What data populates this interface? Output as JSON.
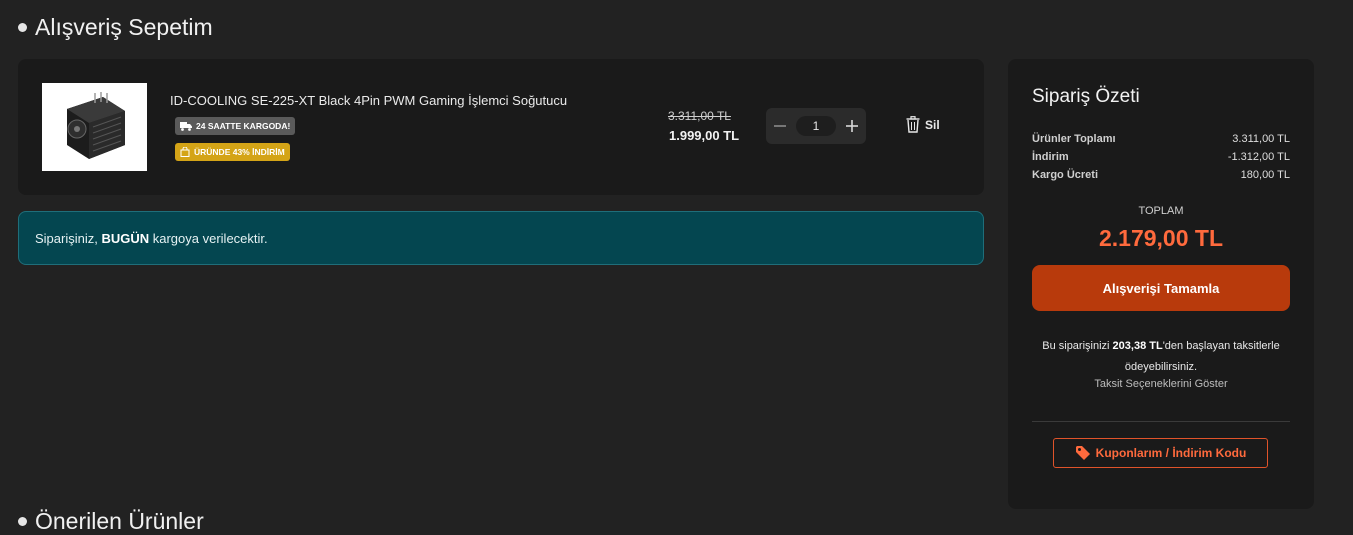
{
  "cart": {
    "title": "Alışveriş Sepetim",
    "items": [
      {
        "name": "ID-COOLING SE-225-XT Black 4Pin PWM Gaming İşlemci Soğutucu",
        "badges": {
          "cargo": "24 SAATTE KARGODA!",
          "discount": "ÜRÜNDE 43% İNDİRİM"
        },
        "old_price": "3.311,00 TL",
        "new_price": "1.999,00 TL",
        "quantity": "1",
        "delete_label": "Sil"
      }
    ]
  },
  "notice": {
    "prefix": "Siparişiniz, ",
    "highlight": "BUGÜN",
    "suffix": " kargoya verilecektir."
  },
  "summary": {
    "title": "Sipariş Özeti",
    "rows": [
      {
        "label": "Ürünler Toplamı",
        "value": "3.311,00 TL"
      },
      {
        "label": "İndirim",
        "value": "-1.312,00 TL"
      },
      {
        "label": "Kargo Ücreti",
        "value": "180,00 TL"
      }
    ],
    "total_label": "TOPLAM",
    "total_value": "2.179,00 TL",
    "checkout_label": "Alışverişi Tamamla",
    "installment": {
      "prefix": "Bu siparişinizi ",
      "amount": "203,38 TL",
      "suffix": "'den başlayan taksitlerle ödeyebilirsiniz.",
      "link": "Taksit Seçeneklerini Göster"
    },
    "coupon_label": "Kuponlarım / İndirim Kodu"
  },
  "recommended": {
    "title": "Önerilen Ürünler"
  },
  "colors": {
    "accent": "#ff6a3d",
    "checkout": "#b83a0c",
    "notice_bg": "#044650",
    "discount_badge": "#d4a417"
  },
  "icons": {
    "truck": "truck-icon",
    "bag": "bag-icon",
    "trash": "trash-icon",
    "tag": "tag-icon",
    "minus": "minus-icon",
    "plus": "plus-icon"
  }
}
